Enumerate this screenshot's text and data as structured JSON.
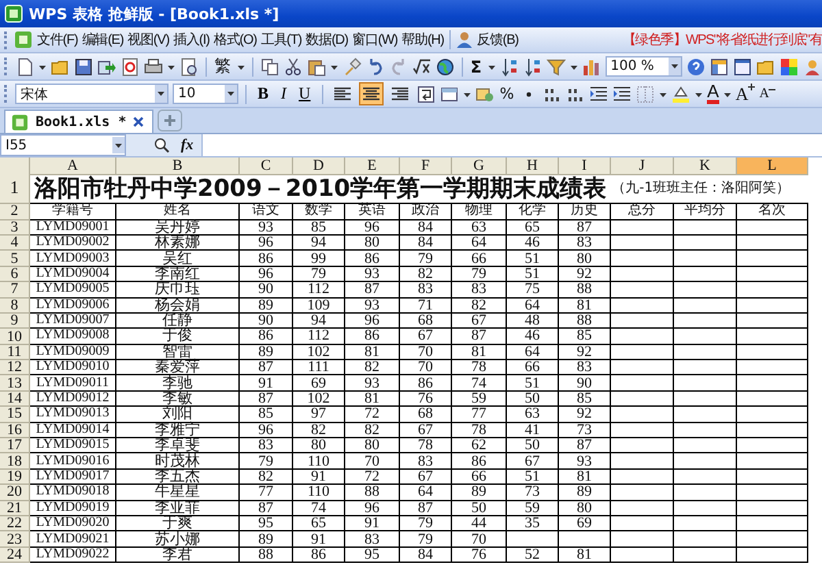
{
  "window": {
    "title": "WPS 表格 抢鲜版 - [Book1.xls *]"
  },
  "menu": {
    "items": [
      "文件(F)",
      "编辑(E)",
      "视图(V)",
      "插入(I)",
      "格式(O)",
      "工具(T)",
      "数据(D)",
      "窗口(W)",
      "帮助(H)"
    ],
    "feedback": "反馈(B)",
    "promo": "【绿色季】WPS\"将省纸进行到底\"有"
  },
  "standard_toolbar": {
    "traditional": "繁",
    "sum": "Σ",
    "zoom": "100 %"
  },
  "format_toolbar": {
    "font": "宋体",
    "size": "10",
    "bold": "B",
    "italic": "I",
    "underline": "U",
    "align": [
      {
        "kind": "left",
        "selected": false
      },
      {
        "kind": "center",
        "selected": true
      },
      {
        "kind": "right",
        "selected": false
      }
    ],
    "percent": "%",
    "font_color": "A",
    "grow": "A",
    "shrink": "A"
  },
  "tabs": [
    {
      "label": "Book1.xls *",
      "selected": true
    }
  ],
  "formula_bar": {
    "name_box": "I55",
    "fx": "fx"
  },
  "sheet": {
    "columns": [
      {
        "label": "A",
        "selected": false
      },
      {
        "label": "B",
        "selected": false
      },
      {
        "label": "C",
        "selected": false
      },
      {
        "label": "D",
        "selected": false
      },
      {
        "label": "E",
        "selected": false
      },
      {
        "label": "F",
        "selected": false
      },
      {
        "label": "G",
        "selected": false
      },
      {
        "label": "H",
        "selected": false
      },
      {
        "label": "I",
        "selected": false
      },
      {
        "label": "J",
        "selected": false
      },
      {
        "label": "K",
        "selected": false
      },
      {
        "label": "L",
        "selected": true
      }
    ],
    "row_numbers": [
      "1",
      "2",
      "3",
      "4",
      "5",
      "6",
      "7",
      "8",
      "9",
      "10",
      "11",
      "12",
      "13",
      "14",
      "15",
      "16",
      "17",
      "18",
      "19",
      "20",
      "21",
      "22",
      "23",
      "24"
    ],
    "title": "洛阳市牡丹中学2009－2010学年第一学期期末成绩表",
    "title_note": "（九-1班班主任：洛阳阿笑）",
    "header": [
      "学籍号",
      "姓名",
      "语文",
      "数学",
      "英语",
      "政治",
      "物理",
      "化学",
      "历史",
      "总分",
      "平均分",
      "名次"
    ],
    "rows": [
      [
        "LYMD09001",
        "吴丹婷",
        "93",
        "85",
        "96",
        "84",
        "63",
        "65",
        "87"
      ],
      [
        "LYMD09002",
        "林素娜",
        "96",
        "94",
        "80",
        "84",
        "64",
        "46",
        "83"
      ],
      [
        "LYMD09003",
        "吴红",
        "86",
        "99",
        "86",
        "79",
        "66",
        "51",
        "80"
      ],
      [
        "LYMD09004",
        "李南红",
        "96",
        "79",
        "93",
        "82",
        "79",
        "51",
        "92"
      ],
      [
        "LYMD09005",
        "庆巾珏",
        "90",
        "112",
        "87",
        "83",
        "83",
        "75",
        "88"
      ],
      [
        "LYMD09006",
        "杨会娟",
        "89",
        "109",
        "93",
        "71",
        "82",
        "64",
        "81"
      ],
      [
        "LYMD09007",
        "任静",
        "90",
        "94",
        "96",
        "68",
        "67",
        "48",
        "88"
      ],
      [
        "LYMD09008",
        "于俊",
        "86",
        "112",
        "86",
        "67",
        "87",
        "46",
        "85"
      ],
      [
        "LYMD09009",
        "智雷",
        "89",
        "102",
        "81",
        "70",
        "81",
        "64",
        "92"
      ],
      [
        "LYMD09010",
        "秦爱萍",
        "87",
        "111",
        "82",
        "70",
        "78",
        "66",
        "83"
      ],
      [
        "LYMD09011",
        "李驰",
        "91",
        "69",
        "93",
        "86",
        "74",
        "51",
        "90"
      ],
      [
        "LYMD09012",
        "李敏",
        "87",
        "102",
        "81",
        "76",
        "59",
        "50",
        "85"
      ],
      [
        "LYMD09013",
        "刘阳",
        "85",
        "97",
        "72",
        "68",
        "77",
        "63",
        "92"
      ],
      [
        "LYMD09014",
        "李雅宁",
        "96",
        "82",
        "82",
        "67",
        "78",
        "41",
        "73"
      ],
      [
        "LYMD09015",
        "李卓斐",
        "83",
        "80",
        "80",
        "78",
        "62",
        "50",
        "87"
      ],
      [
        "LYMD09016",
        "时茂林",
        "79",
        "110",
        "70",
        "83",
        "86",
        "67",
        "93"
      ],
      [
        "LYMD09017",
        "李五杰",
        "82",
        "91",
        "72",
        "67",
        "66",
        "51",
        "81"
      ],
      [
        "LYMD09018",
        "牛星星",
        "77",
        "110",
        "88",
        "64",
        "89",
        "73",
        "89"
      ],
      [
        "LYMD09019",
        "李亚菲",
        "87",
        "74",
        "96",
        "87",
        "50",
        "59",
        "80"
      ],
      [
        "LYMD09020",
        "于爽",
        "95",
        "65",
        "91",
        "79",
        "44",
        "35",
        "69"
      ],
      [
        "LYMD09021",
        "苏小娜",
        "89",
        "91",
        "83",
        "79",
        "70"
      ],
      [
        "LYMD09022",
        "李君",
        "88",
        "86",
        "95",
        "84",
        "76",
        "52",
        "81"
      ]
    ]
  }
}
